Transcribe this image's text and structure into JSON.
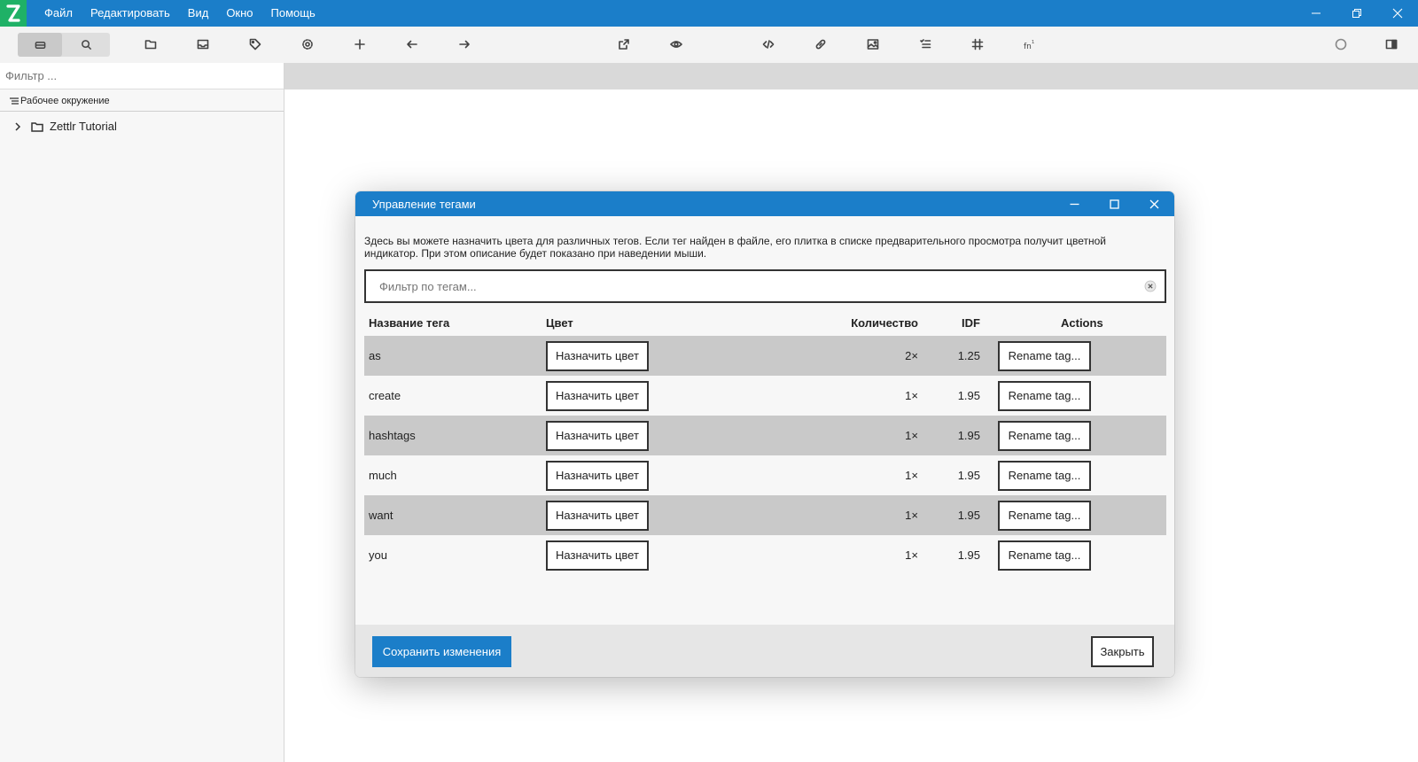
{
  "menu": {
    "file": "Файл",
    "edit": "Редактировать",
    "view": "Вид",
    "window": "Окно",
    "help": "Помощь"
  },
  "sidebar": {
    "filter_placeholder": "Фильтр ...",
    "workspace_label": "Рабочее окружение",
    "tree": [
      {
        "label": "Zettlr Tutorial",
        "type": "folder",
        "expanded": false
      }
    ]
  },
  "toolbar_icons": [
    "file-manager-icon",
    "search-icon",
    "open-folder-icon",
    "inbox-icon",
    "tag-icon",
    "settings-icon",
    "plus-icon",
    "back-arrow-icon",
    "forward-arrow-icon",
    "export-icon",
    "preview-eye-icon",
    "code-icon",
    "link-icon",
    "image-icon",
    "list-icon",
    "table-icon",
    "footnote-icon",
    "pomodoro-icon",
    "sidebar-right-icon"
  ],
  "dialog": {
    "title": "Управление тегами",
    "description": "Здесь вы можете назначить цвета для различных тегов. Если тег найден в файле, его плитка в списке предварительного просмотра получит цветной индикатор. При этом описание будет показано при наведении мыши.",
    "filter_placeholder": "Фильтр по тегам...",
    "columns": {
      "name": "Название тега",
      "color": "Цвет",
      "count": "Количество",
      "idf": "IDF",
      "actions": "Actions"
    },
    "assign_color_label": "Назначить цвет",
    "rename_label": "Rename tag...",
    "rows": [
      {
        "name": "as",
        "count": "2×",
        "idf": "1.25"
      },
      {
        "name": "create",
        "count": "1×",
        "idf": "1.95"
      },
      {
        "name": "hashtags",
        "count": "1×",
        "idf": "1.95"
      },
      {
        "name": "much",
        "count": "1×",
        "idf": "1.95"
      },
      {
        "name": "want",
        "count": "1×",
        "idf": "1.95"
      },
      {
        "name": "you",
        "count": "1×",
        "idf": "1.95"
      }
    ],
    "save_label": "Сохранить изменения",
    "close_label": "Закрыть"
  },
  "colors": {
    "accent": "#1b7ec9",
    "logo": "#1fb166",
    "row_stripe": "#c9c9c9"
  }
}
